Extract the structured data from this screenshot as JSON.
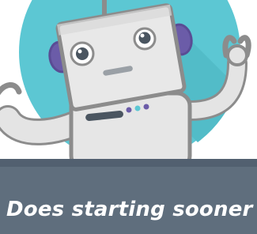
{
  "headline": {
    "text": "Does starting sooner"
  },
  "illustration": {
    "subject": "robot-mascot-waving",
    "icon": "robot-icon"
  },
  "colors": {
    "circle_teal": "#5cc7d3",
    "circle_shadow": "#4fb3be",
    "robot_body": "#e8e8e8",
    "robot_outline": "#8a8a8a",
    "robot_ears": "#6b5ca8",
    "eye_dark": "#4a5560",
    "dot_purple": "#6b5ca8",
    "dot_teal": "#5cc7d3",
    "banner": "#5f6e7d",
    "headline": "#ffffff"
  }
}
